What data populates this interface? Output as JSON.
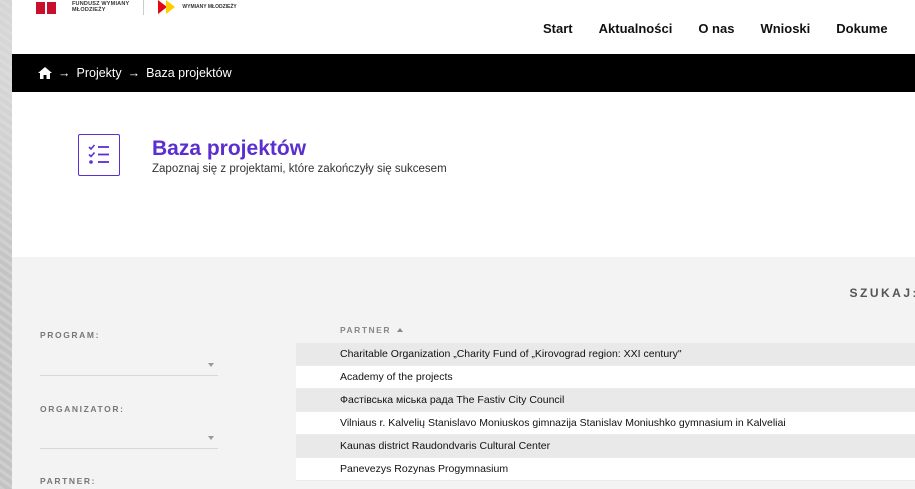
{
  "header": {
    "logo1_text_line1": "FUNDUSZ WYMIANY",
    "logo1_text_line2": "MŁODZIEŻY",
    "logo2_text": "WYMIANY MŁODZIEŻY",
    "nav": [
      "Start",
      "Aktualności",
      "O nas",
      "Wnioski",
      "Dokume"
    ]
  },
  "breadcrumb": {
    "home_icon": "home-icon",
    "separator": "→",
    "items": [
      "Projekty",
      "Baza projektów"
    ]
  },
  "page": {
    "title": "Baza projektów",
    "subtitle": "Zapoznaj się z projektami, które zakończyły się sukcesem",
    "title_icon": "checklist-icon",
    "accent_color": "#5b2ed0"
  },
  "search": {
    "label": "SZUKAJ:"
  },
  "filters": [
    {
      "label": "PROGRAM:",
      "value": ""
    },
    {
      "label": "ORGANIZATOR:",
      "value": ""
    },
    {
      "label": "PARTNER:",
      "value": ""
    }
  ],
  "table": {
    "column": "PARTNER",
    "sort": "ascending",
    "rows": [
      "Charitable Organization „Charity Fund of „Kirovograd region: XXI century\"",
      "Academy of the projects",
      "Фастівська міська рада The Fastiv City Council",
      "Vilniaus r. Kalvelių Stanislavo Moniuskos gimnazija Stanislav Moniushko gymnasium in Kalveliai",
      "Kaunas district Raudondvaris Cultural Center",
      "Panevezys Rozynas Progymnasium"
    ]
  }
}
